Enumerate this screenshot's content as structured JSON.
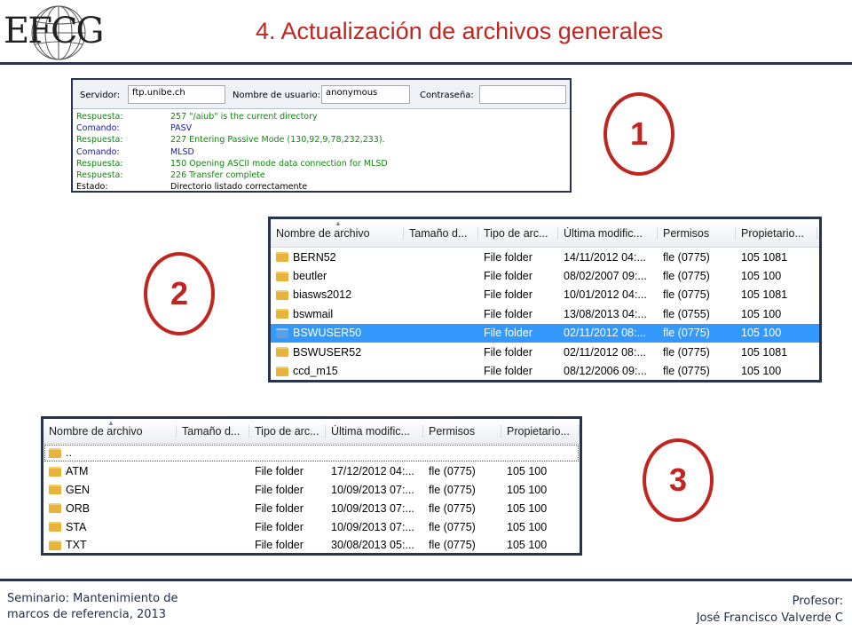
{
  "logo": {
    "text": "EFCG"
  },
  "header": {
    "title": "4. Actualización de archivos generales"
  },
  "markers": [
    "1",
    "2",
    "3"
  ],
  "ftp": {
    "server_label": "Servidor:",
    "server_value": "ftp.unibe.ch",
    "user_label": "Nombre de usuario:",
    "user_value": "anonymous",
    "password_label": "Contraseña:",
    "password_value": "",
    "log": [
      {
        "type": "Respuesta:",
        "text": "257 \"/aiub\" is the current directory",
        "kind": "resp"
      },
      {
        "type": "Comando:",
        "text": "PASV",
        "kind": "cmd"
      },
      {
        "type": "Respuesta:",
        "text": "227 Entering Passive Mode (130,92,9,78,232,233).",
        "kind": "resp"
      },
      {
        "type": "Comando:",
        "text": "MLSD",
        "kind": "cmd"
      },
      {
        "type": "Respuesta:",
        "text": "150 Opening ASCII mode data connection for MLSD",
        "kind": "resp"
      },
      {
        "type": "Respuesta:",
        "text": "226 Transfer complete",
        "kind": "resp"
      },
      {
        "type": "Estado:",
        "text": "Directorio listado correctamente",
        "kind": "state"
      }
    ],
    "colors": {
      "resp": "#0b8a0b",
      "cmd": "#1a1aa8",
      "state": "#000000"
    }
  },
  "list2": {
    "columns": [
      "Nombre de archivo",
      "Tamaño d...",
      "Tipo de arc...",
      "Última modific...",
      "Permisos",
      "Propietario..."
    ],
    "rows": [
      {
        "name": "BERN52",
        "size": "",
        "type": "File folder",
        "modified": "14/11/2012 04:...",
        "perms": "fle (0775)",
        "owner": "105 1081"
      },
      {
        "name": "beutler",
        "size": "",
        "type": "File folder",
        "modified": "08/02/2007 09:...",
        "perms": "fle (0775)",
        "owner": "105 100"
      },
      {
        "name": "biasws2012",
        "size": "",
        "type": "File folder",
        "modified": "10/01/2012 04:...",
        "perms": "fle (0775)",
        "owner": "105 1081"
      },
      {
        "name": "bswmail",
        "size": "",
        "type": "File folder",
        "modified": "13/08/2013 04:...",
        "perms": "fle (0755)",
        "owner": "105 100"
      },
      {
        "name": "BSWUSER50",
        "size": "",
        "type": "File folder",
        "modified": "02/11/2012 08:...",
        "perms": "fle (0775)",
        "owner": "105 100",
        "selected": true
      },
      {
        "name": "BSWUSER52",
        "size": "",
        "type": "File folder",
        "modified": "02/11/2012 08:...",
        "perms": "fle (0775)",
        "owner": "105 1081"
      },
      {
        "name": "ccd_m15",
        "size": "",
        "type": "File folder",
        "modified": "08/12/2006 09:...",
        "perms": "fle (0775)",
        "owner": "105 100"
      }
    ],
    "selection_color": "#3399ff"
  },
  "list3": {
    "columns": [
      "Nombre de archivo",
      "Tamaño d...",
      "Tipo de arc...",
      "Última modific...",
      "Permisos",
      "Propietario..."
    ],
    "rows": [
      {
        "name": "..",
        "size": "",
        "type": "",
        "modified": "",
        "perms": "",
        "owner": "",
        "focused": true
      },
      {
        "name": "ATM",
        "size": "",
        "type": "File folder",
        "modified": "17/12/2012 04:...",
        "perms": "fle (0775)",
        "owner": "105 100"
      },
      {
        "name": "GEN",
        "size": "",
        "type": "File folder",
        "modified": "10/09/2013 07:...",
        "perms": "fle (0775)",
        "owner": "105 100"
      },
      {
        "name": "ORB",
        "size": "",
        "type": "File folder",
        "modified": "10/09/2013 07:...",
        "perms": "fle (0775)",
        "owner": "105 100"
      },
      {
        "name": "STA",
        "size": "",
        "type": "File folder",
        "modified": "10/09/2013 07:...",
        "perms": "fle (0775)",
        "owner": "105 100"
      },
      {
        "name": "TXT",
        "size": "",
        "type": "File folder",
        "modified": "30/08/2013 05:...",
        "perms": "fle (0775)",
        "owner": "105 100"
      }
    ]
  },
  "footer": {
    "left_line1": "Seminario: Mantenimiento de",
    "left_line2": "marcos de referencia, 2013",
    "right_line1": "Profesor:",
    "right_line2": "José Francisco Valverde C"
  },
  "theme": {
    "accent": "#c0261f",
    "rule": "#27344f",
    "footer_text": "#1f2d4a"
  }
}
